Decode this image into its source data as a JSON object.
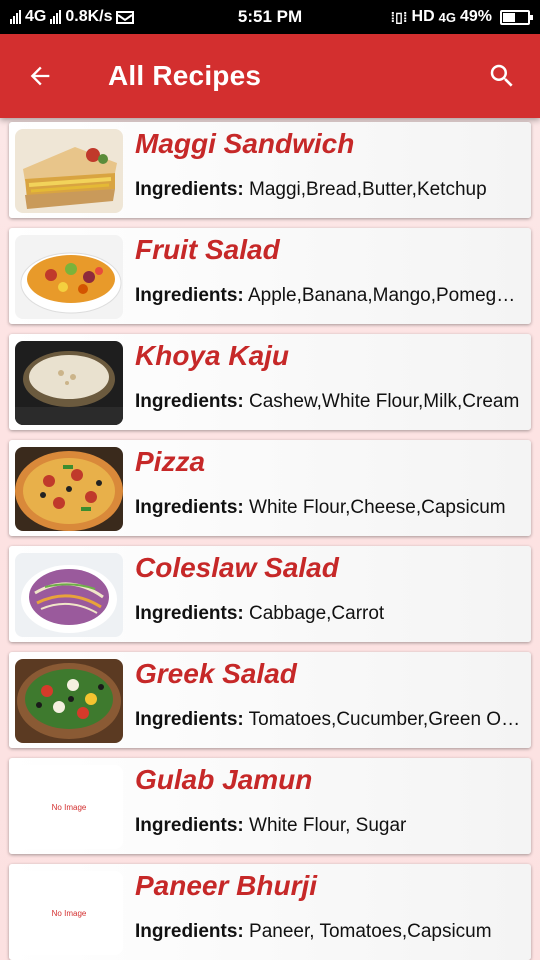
{
  "status_bar": {
    "network_left": "4G",
    "speed": "0.8K/s",
    "time": "5:51 PM",
    "network_right": "HD",
    "network_right2": "4G",
    "battery": "49%",
    "battery_level": 0.49
  },
  "app_bar": {
    "title": "All Recipes",
    "back_icon": "arrow-back-icon",
    "search_icon": "search-icon",
    "color": "#d32f2f"
  },
  "ingredients_label": "Ingredients:",
  "placeholder_text": "No Image",
  "recipes": [
    {
      "name": "Maggi Sandwich",
      "ingredients": "Maggi,Bread,Butter,Ketchup"
    },
    {
      "name": "Fruit Salad",
      "ingredients": "Apple,Banana,Mango,Pomegranate"
    },
    {
      "name": "Khoya Kaju",
      "ingredients": "Cashew,White Flour,Milk,Cream"
    },
    {
      "name": "Pizza",
      "ingredients": "White Flour,Cheese,Capsicum"
    },
    {
      "name": "Coleslaw Salad",
      "ingredients": "Cabbage,Carrot"
    },
    {
      "name": "Greek Salad",
      "ingredients": "Tomatoes,Cucumber,Green Olives"
    },
    {
      "name": "Gulab Jamun",
      "ingredients": "White Flour, Sugar"
    },
    {
      "name": "Paneer Bhurji",
      "ingredients": "Paneer, Tomatoes,Capsicum"
    }
  ]
}
